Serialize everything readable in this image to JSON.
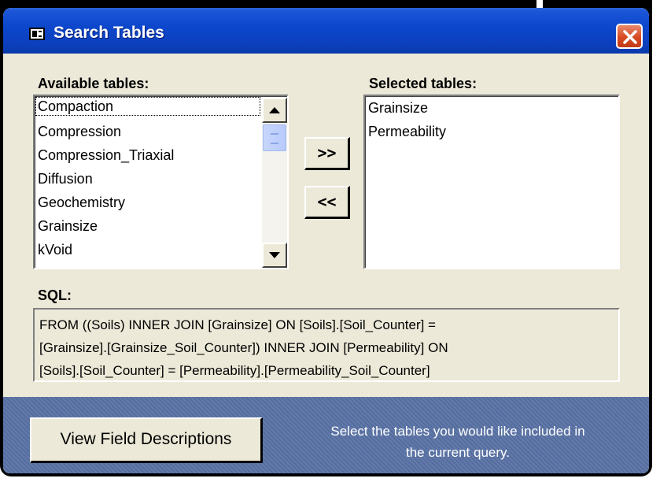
{
  "window": {
    "title": "Search Tables"
  },
  "available": {
    "label": "Available tables:",
    "items": [
      "Compaction",
      "Compression",
      "Compression_Triaxial",
      "Diffusion",
      "Geochemistry",
      "Grainsize",
      "kVoid"
    ],
    "scroll_buttons": {
      "up": "▲",
      "down": "▼"
    }
  },
  "buttons": {
    "add": ">>",
    "remove": "<<",
    "view_field_descriptions": "View Field Descriptions"
  },
  "selected": {
    "label": "Selected tables:",
    "items": [
      "Grainsize",
      "Permeability"
    ]
  },
  "sql": {
    "label": "SQL:",
    "lines": [
      "FROM ((Soils) INNER JOIN [Grainsize] ON [Soils].[Soil_Counter] =",
      "[Grainsize].[Grainsize_Soil_Counter]) INNER JOIN [Permeability] ON",
      "[Soils].[Soil_Counter] = [Permeability].[Permeability_Soil_Counter]"
    ]
  },
  "footer": {
    "hint_lines": [
      "Select the tables you would like included in",
      "the current query."
    ]
  },
  "colors": {
    "titlebar": "#0d47cc",
    "window_bg": "#ece9d8",
    "footer_bg": "#5a73a6",
    "close_button": "#d74a22"
  },
  "icons": {
    "app": "form-icon",
    "close": "close-icon"
  }
}
